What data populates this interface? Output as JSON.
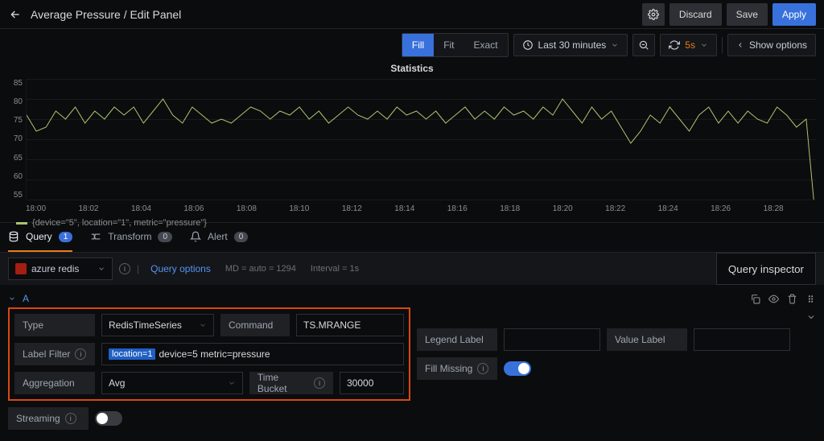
{
  "header": {
    "title": "Average Pressure / Edit Panel",
    "discard": "Discard",
    "save": "Save",
    "apply": "Apply"
  },
  "toolbar": {
    "fill": "Fill",
    "fit": "Fit",
    "exact": "Exact",
    "timerange": "Last 30 minutes",
    "refresh_interval": "5s",
    "show_options": "Show options"
  },
  "chart_data": {
    "type": "line",
    "title": "Statistics",
    "ylim": [
      55,
      85
    ],
    "yticks": [
      85,
      80,
      75,
      70,
      65,
      60,
      55
    ],
    "categories": [
      "18:00",
      "18:02",
      "18:04",
      "18:06",
      "18:08",
      "18:10",
      "18:12",
      "18:14",
      "18:16",
      "18:18",
      "18:20",
      "18:22",
      "18:24",
      "18:26",
      "18:28"
    ],
    "series": [
      {
        "name": "{device=\"5\", location=\"1\", metric=\"pressure\"}",
        "values": [
          76,
          72,
          73,
          77,
          75,
          78,
          74,
          77,
          75,
          78,
          76,
          78,
          74,
          77,
          80,
          76,
          74,
          78,
          76,
          74,
          75,
          74,
          76,
          78,
          77,
          75,
          77,
          76,
          78,
          75,
          77,
          74,
          76,
          78,
          76,
          75,
          77,
          75,
          78,
          76,
          77,
          75,
          77,
          74,
          76,
          78,
          75,
          77,
          75,
          78,
          76,
          77,
          75,
          78,
          76,
          80,
          77,
          74,
          78,
          75,
          77,
          73,
          69,
          72,
          76,
          74,
          78,
          75,
          72,
          76,
          78,
          74,
          77,
          74,
          77,
          75,
          74,
          78,
          76,
          73,
          75,
          49
        ]
      }
    ],
    "legend_label": "{device=\"5\", location=\"1\", metric=\"pressure\"}"
  },
  "tabs": {
    "query": "Query",
    "query_count": "1",
    "transform": "Transform",
    "transform_count": "0",
    "alert": "Alert",
    "alert_count": "0"
  },
  "datasource": {
    "name": "azure redis",
    "query_options": "Query options",
    "md": "MD = auto = 1294",
    "interval": "Interval = 1s",
    "inspector": "Query inspector"
  },
  "query": {
    "ref": "A",
    "type_label": "Type",
    "type_value": "RedisTimeSeries",
    "command_label": "Command",
    "command_value": "TS.MRANGE",
    "labelfilter_label": "Label Filter",
    "labelfilter_token": "location=1",
    "labelfilter_rest": " device=5 metric=pressure",
    "aggregation_label": "Aggregation",
    "aggregation_value": "Avg",
    "timebucket_label": "Time Bucket",
    "timebucket_value": "30000",
    "legendlabel_label": "Legend Label",
    "valuelabel_label": "Value Label",
    "fillmissing_label": "Fill Missing",
    "streaming_label": "Streaming"
  }
}
